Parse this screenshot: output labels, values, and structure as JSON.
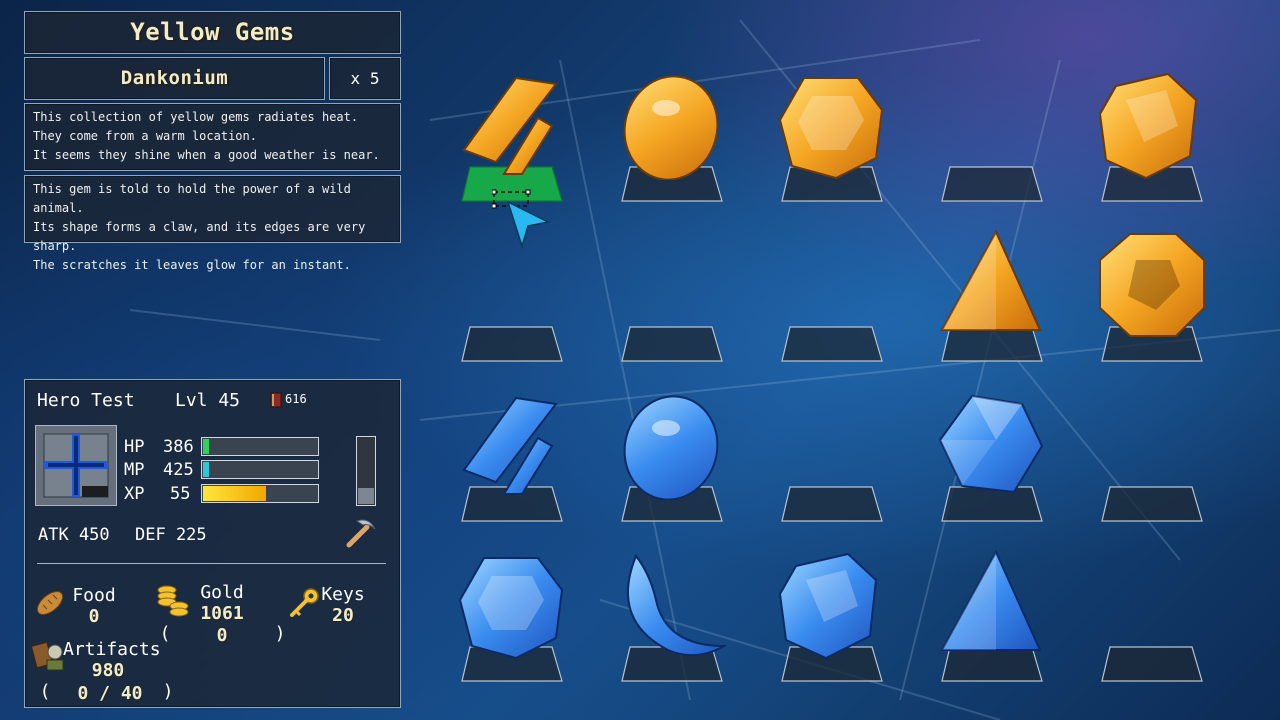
{
  "collection": {
    "title": "Yellow Gems",
    "item_name": "Dankonium",
    "item_count": "x 5",
    "collection_desc": "This collection of yellow gems radiates heat.\nThey come from a warm location.\nIt seems they shine when a good weather is near.",
    "item_desc": "This gem is told to hold the power of a wild animal.\nIts shape forms a claw, and its edges are very sharp.\nThe scratches it leaves glow for an instant."
  },
  "hero": {
    "name": "Hero Test",
    "level": "Lvl 45",
    "book_count": "616",
    "hp_label": "HP",
    "hp_value": "386",
    "hp_fill": 0.05,
    "mp_label": "MP",
    "mp_value": "425",
    "mp_fill": 0.05,
    "xp_label": "XP",
    "xp_value": "55",
    "xp_fill": 0.55,
    "side_gauge_fill": 0.25,
    "atk": "ATK  450",
    "def": "DEF  225"
  },
  "resources": {
    "food_label": "Food",
    "food_value": "0",
    "gold_label": "Gold",
    "gold_value": "1061",
    "gold_sub": "0",
    "keys_label": "Keys",
    "keys_value": "20",
    "artifacts_label": "Artifacts",
    "artifacts_value": "980",
    "artifacts_sub": "0 / 40",
    "paren_open": "(",
    "paren_close": ")"
  },
  "colors": {
    "hp": "#2fd35a",
    "mp": "#2cc8d8",
    "xp_from": "#ffe63a",
    "xp_to": "#f0a800",
    "selected_slot": "#17a84a",
    "cursor": "#2ab8f0"
  },
  "gem_grid": {
    "rows": [
      [
        "yellow-claw-gem",
        "yellow-egg-gem",
        "yellow-hexagon-gem",
        "empty",
        "yellow-rough-gem"
      ],
      [
        "empty",
        "empty",
        "empty",
        "yellow-triangle-gem",
        "yellow-octagon-gem"
      ],
      [
        "blue-claw-gem",
        "blue-egg-gem",
        "empty",
        "blue-faceted-gem",
        "empty"
      ],
      [
        "blue-hexagon-gem",
        "blue-crescent-gem",
        "blue-rough-gem",
        "blue-triangle-gem",
        "empty"
      ]
    ],
    "selected": "yellow-claw-gem"
  }
}
